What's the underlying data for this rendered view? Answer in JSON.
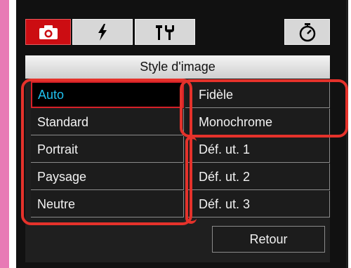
{
  "tabs": [
    {
      "icon": "camera-icon",
      "active": true
    },
    {
      "icon": "flash-icon",
      "active": false
    },
    {
      "icon": "tools-icon",
      "active": false
    },
    {
      "icon": "timer-icon",
      "active": false
    }
  ],
  "menu": {
    "title": "Style d'image",
    "left_items": [
      "Auto",
      "Standard",
      "Portrait",
      "Paysage",
      "Neutre"
    ],
    "right_items": [
      "Fidèle",
      "Monochrome",
      "Déf. ut. 1",
      "Déf. ut. 2",
      "Déf. ut. 3"
    ],
    "selected": "Auto",
    "back_label": "Retour"
  },
  "colors": {
    "active_tab": "#cc0d12",
    "selected_text": "#1fc0ee",
    "highlight": "#e5322b",
    "side_bar": "#e87ab5"
  }
}
